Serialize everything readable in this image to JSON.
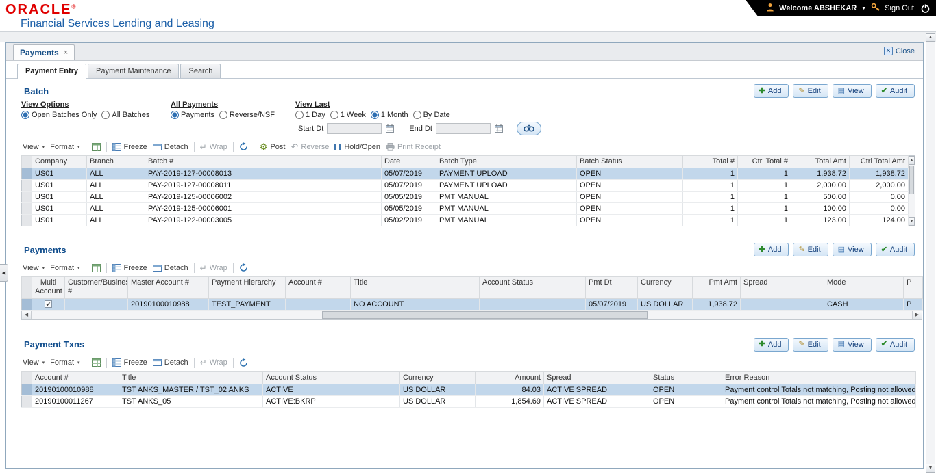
{
  "header": {
    "brand": "ORACLE",
    "brand_mark": "®",
    "app_title": "Financial Services Lending and Leasing",
    "welcome": "Welcome ABSHEKAR",
    "sign_out": "Sign Out"
  },
  "page": {
    "doc_tab": "Payments",
    "close_label": "Close"
  },
  "tabs": [
    {
      "label": "Payment Entry"
    },
    {
      "label": "Payment Maintenance"
    },
    {
      "label": "Search"
    }
  ],
  "actions": {
    "add": "Add",
    "edit": "Edit",
    "view": "View",
    "audit": "Audit"
  },
  "toolbar": {
    "view": "View",
    "format": "Format",
    "freeze": "Freeze",
    "detach": "Detach",
    "wrap": "Wrap",
    "post": "Post",
    "reverse": "Reverse",
    "hold_open": "Hold/Open",
    "print_receipt": "Print Receipt"
  },
  "filters": {
    "view_options": {
      "label": "View Options",
      "options": [
        {
          "label": "Open Batches Only",
          "checked": true
        },
        {
          "label": "All Batches",
          "checked": false
        }
      ]
    },
    "all_payments": {
      "label": "All Payments",
      "options": [
        {
          "label": "Payments",
          "checked": true
        },
        {
          "label": "Reverse/NSF",
          "checked": false
        }
      ]
    },
    "view_last": {
      "label": "View Last",
      "options": [
        {
          "label": "1 Day",
          "checked": false
        },
        {
          "label": "1 Week",
          "checked": false
        },
        {
          "label": "1 Month",
          "checked": true
        },
        {
          "label": "By Date",
          "checked": false
        }
      ]
    },
    "start_dt_label": "Start Dt",
    "end_dt_label": "End Dt",
    "start_dt_value": "",
    "end_dt_value": ""
  },
  "batch": {
    "title": "Batch",
    "table": {
      "columns": [
        "Company",
        "Branch",
        "Batch #",
        "Date",
        "Batch Type",
        "Batch Status",
        "Total #",
        "Ctrl Total #",
        "Total Amt",
        "Ctrl Total Amt"
      ],
      "widths": [
        80,
        85,
        345,
        80,
        205,
        155,
        80,
        78,
        85,
        86
      ],
      "align": [
        "l",
        "l",
        "l",
        "l",
        "l",
        "l",
        "r",
        "r",
        "r",
        "r"
      ],
      "selected_row": 0,
      "rows": [
        [
          "US01",
          "ALL",
          "PAY-2019-127-00008013",
          "05/07/2019",
          "PAYMENT UPLOAD",
          "OPEN",
          "1",
          "1",
          "1,938.72",
          "1,938.72"
        ],
        [
          "US01",
          "ALL",
          "PAY-2019-127-00008011",
          "05/07/2019",
          "PAYMENT UPLOAD",
          "OPEN",
          "1",
          "1",
          "2,000.00",
          "2,000.00"
        ],
        [
          "US01",
          "ALL",
          "PAY-2019-125-00006002",
          "05/05/2019",
          "PMT MANUAL",
          "OPEN",
          "1",
          "1",
          "500.00",
          "0.00"
        ],
        [
          "US01",
          "ALL",
          "PAY-2019-125-00006001",
          "05/05/2019",
          "PMT MANUAL",
          "OPEN",
          "1",
          "1",
          "100.00",
          "0.00"
        ],
        [
          "US01",
          "ALL",
          "PAY-2019-122-00003005",
          "05/02/2019",
          "PMT MANUAL",
          "OPEN",
          "1",
          "1",
          "123.00",
          "124.00"
        ]
      ]
    }
  },
  "payments": {
    "title": "Payments",
    "table": {
      "columns": [
        "Multi Account",
        "Customer/Business #",
        "Master Account #",
        "Payment Hierarchy",
        "Account #",
        "Title",
        "Account Status",
        "Pmt Dt",
        "Currency",
        "Pmt Amt",
        "Spread",
        "Mode",
        "P"
      ],
      "widths": [
        48,
        92,
        118,
        112,
        95,
        188,
        155,
        76,
        80,
        70,
        122,
        116,
        28
      ],
      "align": [
        "c",
        "l",
        "l",
        "l",
        "l",
        "l",
        "l",
        "l",
        "l",
        "r",
        "l",
        "l",
        "l"
      ],
      "selected_row": 0,
      "rows": [
        [
          "✔",
          "",
          "20190100010988",
          "TEST_PAYMENT",
          "",
          "NO ACCOUNT",
          "",
          "05/07/2019",
          "US DOLLAR",
          "1,938.72",
          "",
          "CASH",
          "P"
        ]
      ]
    }
  },
  "payment_txns": {
    "title": "Payment Txns",
    "table": {
      "columns": [
        "Account #",
        "Title",
        "Account Status",
        "Currency",
        "Amount",
        "Spread",
        "Status",
        "Error Reason"
      ],
      "widths": [
        127,
        210,
        200,
        110,
        100,
        155,
        105,
        283
      ],
      "align": [
        "l",
        "l",
        "l",
        "l",
        "r",
        "l",
        "l",
        "l"
      ],
      "selected_row": 0,
      "rows": [
        [
          "20190100010988",
          "TST ANKS_MASTER / TST_02 ANKS",
          "ACTIVE",
          "US DOLLAR",
          "84.03",
          "ACTIVE SPREAD",
          "OPEN",
          "Payment control Totals not matching, Posting not allowed"
        ],
        [
          "20190100011267",
          "TST ANKS_05",
          "ACTIVE:BKRP",
          "US DOLLAR",
          "1,854.69",
          "ACTIVE SPREAD",
          "OPEN",
          "Payment control Totals not matching, Posting not allowed"
        ]
      ]
    }
  }
}
